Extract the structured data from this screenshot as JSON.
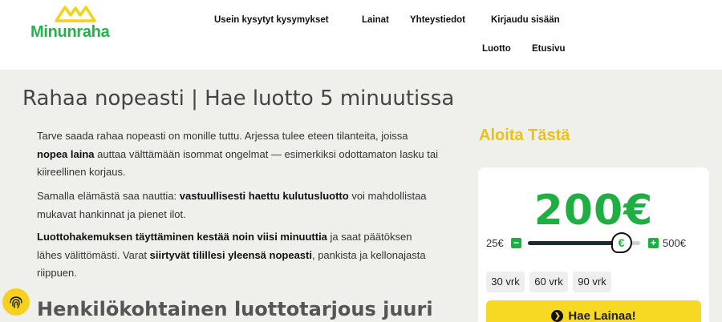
{
  "brand": {
    "name": "Minunraha",
    "logo_color": "#f2d21a",
    "text_color": "#22b14c"
  },
  "nav": {
    "faq": "Usein kysytyt kysymykset",
    "loans": "Lainat",
    "contact": "Yhteystiedot",
    "login": "Kirjaudu sisään",
    "credit": "Luotto",
    "home": "Etusivu"
  },
  "main": {
    "title": "Rahaa nopeasti | Hae luotto 5 minuutissa",
    "p1": [
      "Tarve saada rahaa nopeasti on monille tuttu. Arjessa tulee eteen tilanteita, joissa ",
      "nopea laina",
      " auttaa välttämään isommat ongelmat — esimerkiksi odottamaton lasku tai kiireellinen korjaus."
    ],
    "p2": [
      "Samalla elämästä saa nauttia: ",
      "vastuullisesti haettu kulutusluotto",
      " voi mahdollistaa mukavat hankinnat ja pienet ilot."
    ],
    "p3": [
      "Luottohakemuksen täyttäminen kestää noin viisi minuuttia",
      " ja saat päätöksen lähes välittömästi. Varat ",
      "siirtyvät tilillesi yleensä nopeasti",
      ", pankista ja kellonajasta riippuen."
    ],
    "subheading": "Henkilökohtainen luottotarjous juuri"
  },
  "calculator": {
    "heading": "Aloita Tästä",
    "amount": "200€",
    "min_label": "25€",
    "max_label": "500€",
    "min_value": 25,
    "max_value": 500,
    "slider_value": 200,
    "thumb_symbol": "€",
    "minus_symbol": "−",
    "plus_symbol": "+",
    "terms": [
      "30 vrk",
      "60 vrk",
      "90 vrk"
    ],
    "apply_label": "Hae Lainaa!",
    "apply_icon": "chevron-right-circle-icon",
    "accent_green": "#1fae42",
    "accent_yellow": "#f7d823"
  },
  "accessibility_icon": "fingerprint-icon"
}
